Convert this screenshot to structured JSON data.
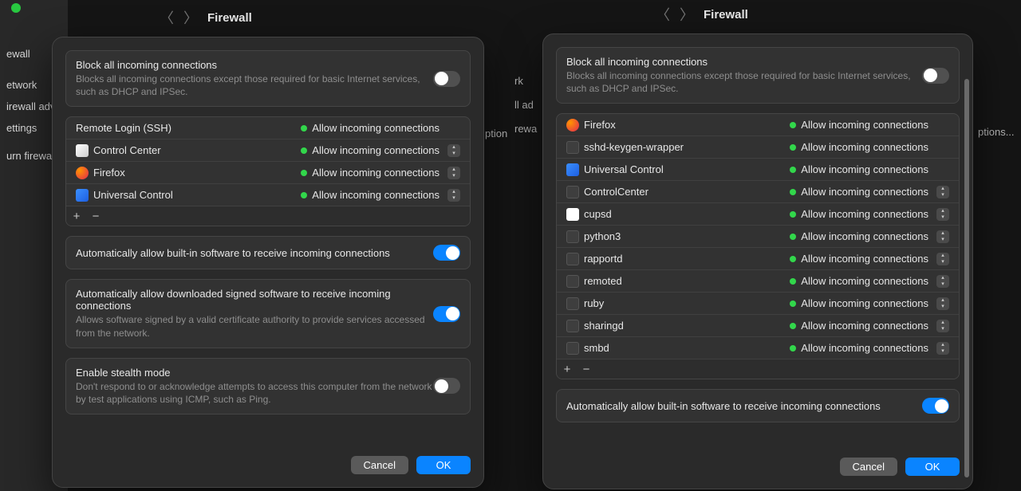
{
  "header": {
    "title_left": "Firewall",
    "title_right": "Firewall"
  },
  "sidebar": {
    "items": [
      "ewall",
      "etwork",
      "irewall adv",
      "ettings",
      "urn firewa"
    ]
  },
  "bg_labels": {
    "options_left": "ption",
    "options_right": "ptions...",
    "rk": "rk",
    "ll_adv": "ll ad",
    "rewall": "rewa"
  },
  "block_all": {
    "title": "Block all incoming connections",
    "subtitle": "Blocks all incoming connections except those required for basic Internet services, such as DHCP and IPSec.",
    "enabled": false
  },
  "left_list": [
    {
      "name": "Remote Login (SSH)",
      "icon": "",
      "status": "Allow incoming connections",
      "stepper": false
    },
    {
      "name": "Control Center",
      "icon": "control",
      "status": "Allow incoming connections",
      "stepper": true
    },
    {
      "name": "Firefox",
      "icon": "firefox",
      "status": "Allow incoming connections",
      "stepper": true
    },
    {
      "name": "Universal Control",
      "icon": "universal",
      "status": "Allow incoming connections",
      "stepper": true
    }
  ],
  "right_list": [
    {
      "name": "Firefox",
      "icon": "firefox",
      "status": "Allow incoming connections",
      "stepper": false
    },
    {
      "name": "sshd-keygen-wrapper",
      "icon": "generic",
      "status": "Allow incoming connections",
      "stepper": false
    },
    {
      "name": "Universal Control",
      "icon": "universal",
      "status": "Allow incoming connections",
      "stepper": false
    },
    {
      "name": "ControlCenter",
      "icon": "generic",
      "status": "Allow incoming connections",
      "stepper": true
    },
    {
      "name": "cupsd",
      "icon": "doc",
      "status": "Allow incoming connections",
      "stepper": true
    },
    {
      "name": "python3",
      "icon": "generic",
      "status": "Allow incoming connections",
      "stepper": true
    },
    {
      "name": "rapportd",
      "icon": "generic",
      "status": "Allow incoming connections",
      "stepper": true
    },
    {
      "name": "remoted",
      "icon": "generic",
      "status": "Allow incoming connections",
      "stepper": true
    },
    {
      "name": "ruby",
      "icon": "generic",
      "status": "Allow incoming connections",
      "stepper": true
    },
    {
      "name": "sharingd",
      "icon": "generic",
      "status": "Allow incoming connections",
      "stepper": true
    },
    {
      "name": "smbd",
      "icon": "generic",
      "status": "Allow incoming connections",
      "stepper": true
    }
  ],
  "auto_builtin": {
    "title": "Automatically allow built-in software to receive incoming connections",
    "enabled": true
  },
  "auto_signed": {
    "title": "Automatically allow downloaded signed software to receive incoming connections",
    "subtitle": "Allows software signed by a valid certificate authority to provide services accessed from the network.",
    "enabled": true
  },
  "stealth": {
    "title": "Enable stealth mode",
    "subtitle": "Don't respond to or acknowledge attempts to access this computer from the network by test applications using ICMP, such as Ping.",
    "enabled": false
  },
  "buttons": {
    "cancel": "Cancel",
    "ok": "OK"
  },
  "footer": {
    "plus": "+",
    "minus": "−"
  }
}
